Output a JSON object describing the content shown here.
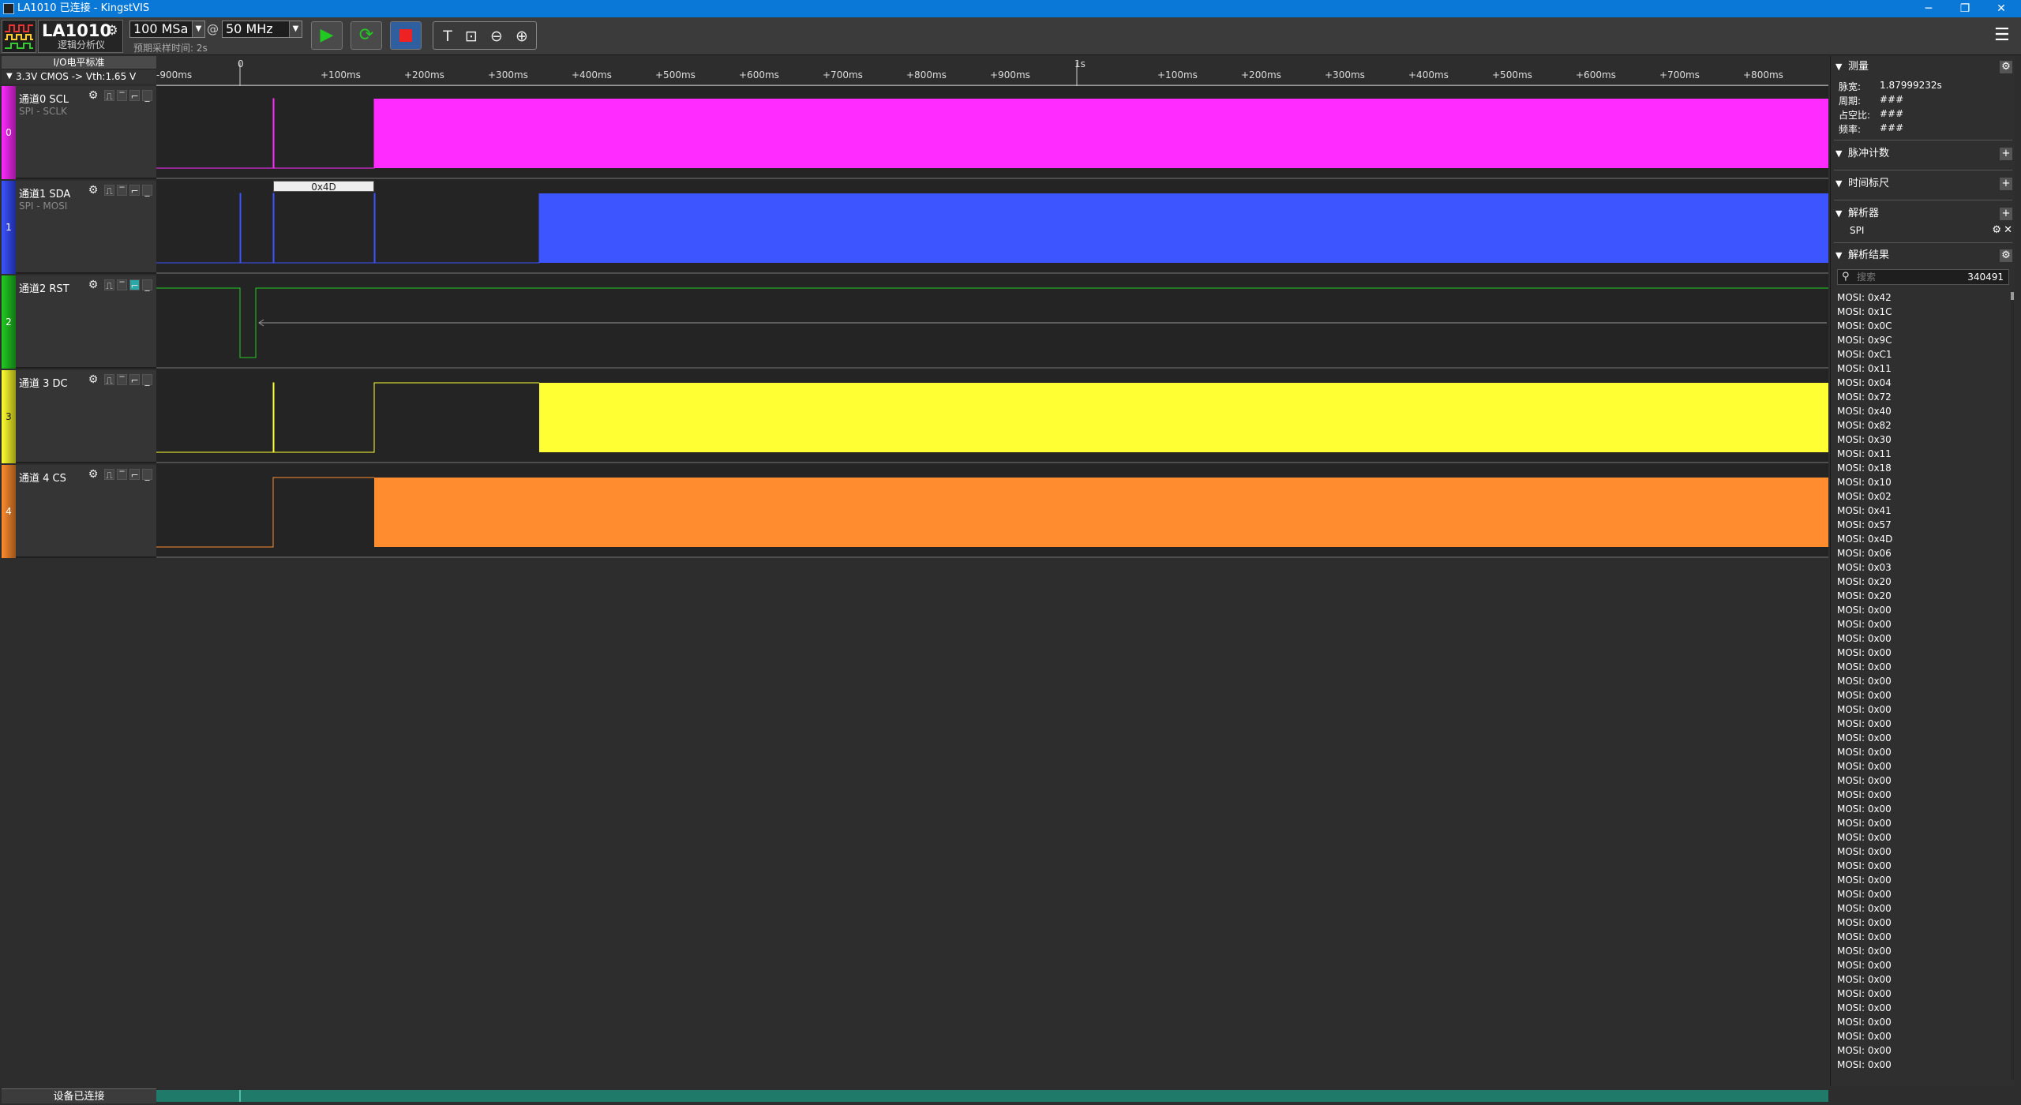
{
  "window": {
    "title": "LA1010 已连接 - KingstVIS",
    "minimize": "─",
    "restore": "❐",
    "close": "✕"
  },
  "toolbar": {
    "device_name": "LA1010",
    "device_sub": "逻辑分析仪",
    "sample_depth": "100 MSa",
    "at": "@",
    "sample_rate": "50 MHz",
    "expected_time": "预期采样时间: 2s",
    "menu_icon": "☰"
  },
  "io": {
    "label": "I/O电平标准",
    "value": "3.3V CMOS   -> Vth:1.65 V"
  },
  "channels": [
    {
      "index": "0",
      "name": "通道0 SCL",
      "sub": "SPI - SCLK",
      "color": "#ff2bff"
    },
    {
      "index": "1",
      "name": "通道1 SDA",
      "sub": "SPI - MOSI",
      "color": "#3d55ff"
    },
    {
      "index": "2",
      "name": "通道2 RST",
      "sub": "",
      "color": "#22cc22"
    },
    {
      "index": "3",
      "name": "通道 3 DC",
      "sub": "",
      "color": "#ffff33"
    },
    {
      "index": "4",
      "name": "通道 4 CS",
      "sub": "",
      "color": "#ff8c2e"
    }
  ],
  "ruler": {
    "ticks": [
      "-900ms",
      "+100ms",
      "+200ms",
      "+300ms",
      "+400ms",
      "+500ms",
      "+600ms",
      "+700ms",
      "+800ms",
      "+900ms",
      "+100ms",
      "+200ms",
      "+300ms",
      "+400ms",
      "+500ms",
      "+600ms",
      "+700ms",
      "+800ms"
    ],
    "majors": [
      "0",
      "1s"
    ]
  },
  "annotation": "0x4D",
  "status": "设备已连接",
  "panel": {
    "measure": "测量",
    "pulse_width_label": "脉宽:",
    "pulse_width_value": "1.87999232s",
    "period_label": "周期:",
    "period_value": "###",
    "duty_label": "占空比:",
    "duty_value": "###",
    "freq_label": "频率:",
    "freq_value": "###",
    "pulse_count": "脉冲计数",
    "time_marker": "时间标尺",
    "analyzers": "解析器",
    "analyzer_item": "SPI",
    "results": "解析结果",
    "search_placeholder": "搜索",
    "results_count": "340491"
  },
  "results": [
    "MOSI: 0x42",
    "MOSI: 0x1C",
    "MOSI: 0x0C",
    "MOSI: 0x9C",
    "MOSI: 0xC1",
    "MOSI: 0x11",
    "MOSI: 0x04",
    "MOSI: 0x72",
    "MOSI: 0x40",
    "MOSI: 0x82",
    "MOSI: 0x30",
    "MOSI: 0x11",
    "MOSI: 0x18",
    "MOSI: 0x10",
    "MOSI: 0x02",
    "MOSI: 0x41",
    "MOSI: 0x57",
    "MOSI: 0x4D",
    "MOSI: 0x06",
    "MOSI: 0x03",
    "MOSI: 0x20",
    "MOSI: 0x20",
    "MOSI: 0x00",
    "MOSI: 0x00",
    "MOSI: 0x00",
    "MOSI: 0x00",
    "MOSI: 0x00",
    "MOSI: 0x00",
    "MOSI: 0x00",
    "MOSI: 0x00",
    "MOSI: 0x00",
    "MOSI: 0x00",
    "MOSI: 0x00",
    "MOSI: 0x00",
    "MOSI: 0x00",
    "MOSI: 0x00",
    "MOSI: 0x00",
    "MOSI: 0x00",
    "MOSI: 0x00",
    "MOSI: 0x00",
    "MOSI: 0x00",
    "MOSI: 0x00",
    "MOSI: 0x00",
    "MOSI: 0x00",
    "MOSI: 0x00",
    "MOSI: 0x00",
    "MOSI: 0x00",
    "MOSI: 0x00",
    "MOSI: 0x00",
    "MOSI: 0x00",
    "MOSI: 0x00",
    "MOSI: 0x00",
    "MOSI: 0x00",
    "MOSI: 0x00",
    "MOSI: 0x00"
  ]
}
